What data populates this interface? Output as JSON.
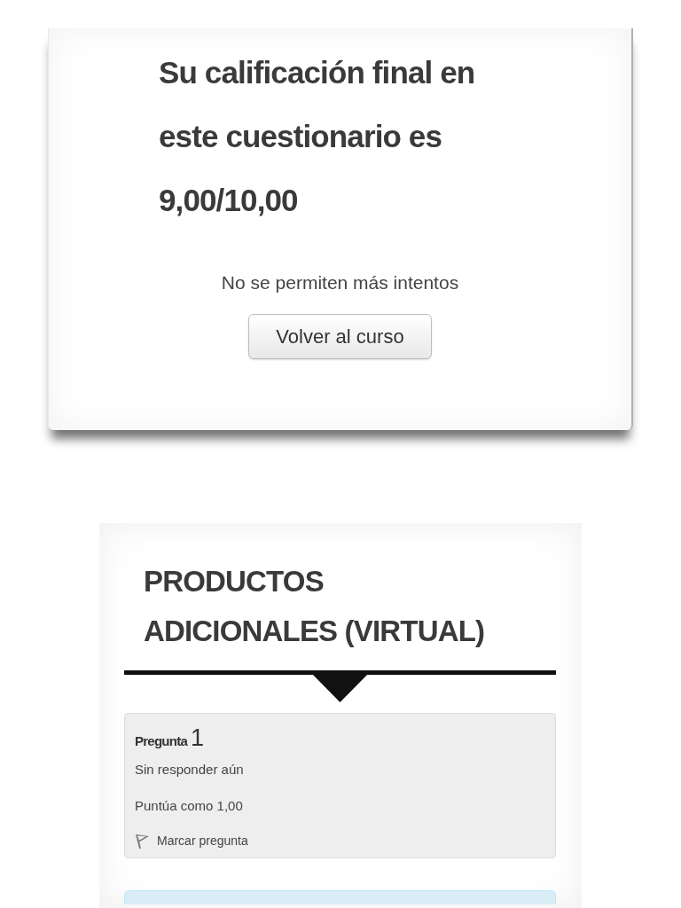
{
  "result_card": {
    "heading": "Su calificación final en este cuestionario es 9,00/10,00",
    "notice": "No se permiten más intentos",
    "button": "Volver al curso"
  },
  "section": {
    "title": "PRODUCTOS ADICIONALES (VIRTUAL)",
    "question": {
      "label": "Pregunta",
      "number": "1",
      "status": "Sin responder aún",
      "grade": "Puntúa como 1,00",
      "flag_link": "Marcar pregunta",
      "flagged": false
    }
  }
}
